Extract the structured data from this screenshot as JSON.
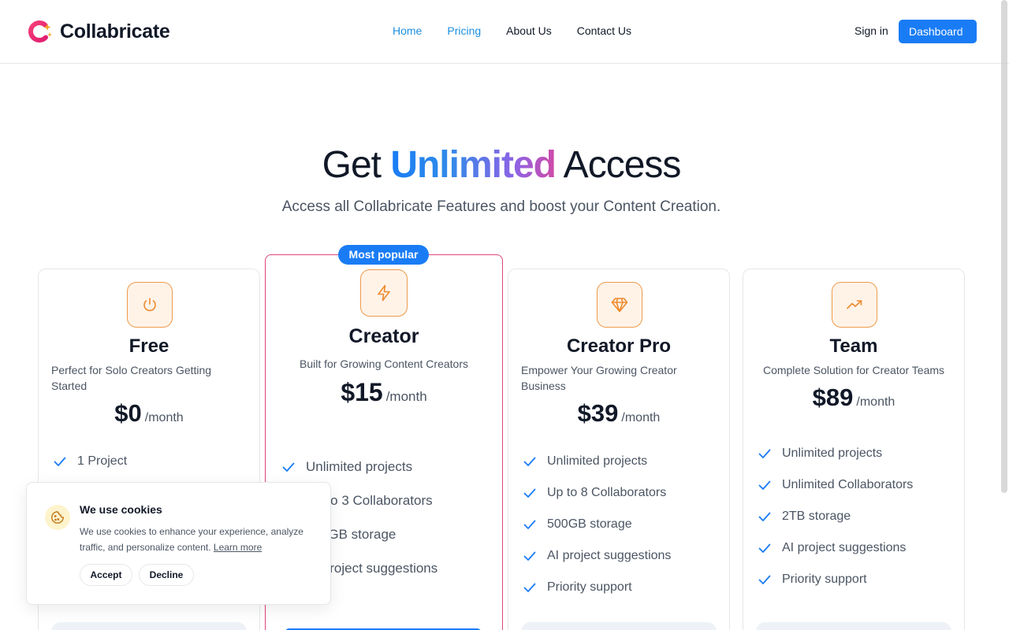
{
  "brand": {
    "name": "Collabricate"
  },
  "nav": {
    "items": [
      {
        "label": "Home",
        "active": true
      },
      {
        "label": "Pricing",
        "active": true
      },
      {
        "label": "About Us",
        "active": false
      },
      {
        "label": "Contact Us",
        "active": false
      }
    ],
    "sign_in": "Sign in",
    "dashboard": "Dashboard"
  },
  "hero": {
    "title_before": "Get ",
    "title_highlight": "Unlimited",
    "title_after": " Access",
    "subtitle": "Access all Collabricate Features and boost your Content Creation."
  },
  "plans": [
    {
      "name": "Free",
      "icon": "power-icon",
      "description": "Perfect for Solo Creators Getting Started",
      "price": "$0",
      "period": "/month",
      "features": [
        "1 Project"
      ]
    },
    {
      "name": "Creator",
      "icon": "lightning-icon",
      "badge": "Most popular",
      "description": "Built for Growing Content Creators",
      "price": "$15",
      "period": "/month",
      "features": [
        "Unlimited projects",
        "Up to 3 Collaborators",
        "100GB storage",
        "AI project suggestions"
      ]
    },
    {
      "name": "Creator Pro",
      "icon": "diamond-icon",
      "description": "Empower Your Growing Creator Business",
      "price": "$39",
      "period": "/month",
      "features": [
        "Unlimited projects",
        "Up to 8 Collaborators",
        "500GB storage",
        "AI project suggestions",
        "Priority support"
      ]
    },
    {
      "name": "Team",
      "icon": "trending-up-icon",
      "description": "Complete Solution for Creator Teams",
      "price": "$89",
      "period": "/month",
      "features": [
        "Unlimited projects",
        "Unlimited Collaborators",
        "2TB storage",
        "AI project suggestions",
        "Priority support"
      ]
    }
  ],
  "cookie": {
    "icon": "cookie-icon",
    "title": "We use cookies",
    "text": "We use cookies to enhance your experience, analyze traffic, and personalize content.",
    "learn_more": "Learn more",
    "accept": "Accept",
    "decline": "Decline"
  },
  "colors": {
    "accent": "#1a7cf5",
    "popular_border": "#e0457a",
    "icon_orange": "#ee8a2e"
  }
}
